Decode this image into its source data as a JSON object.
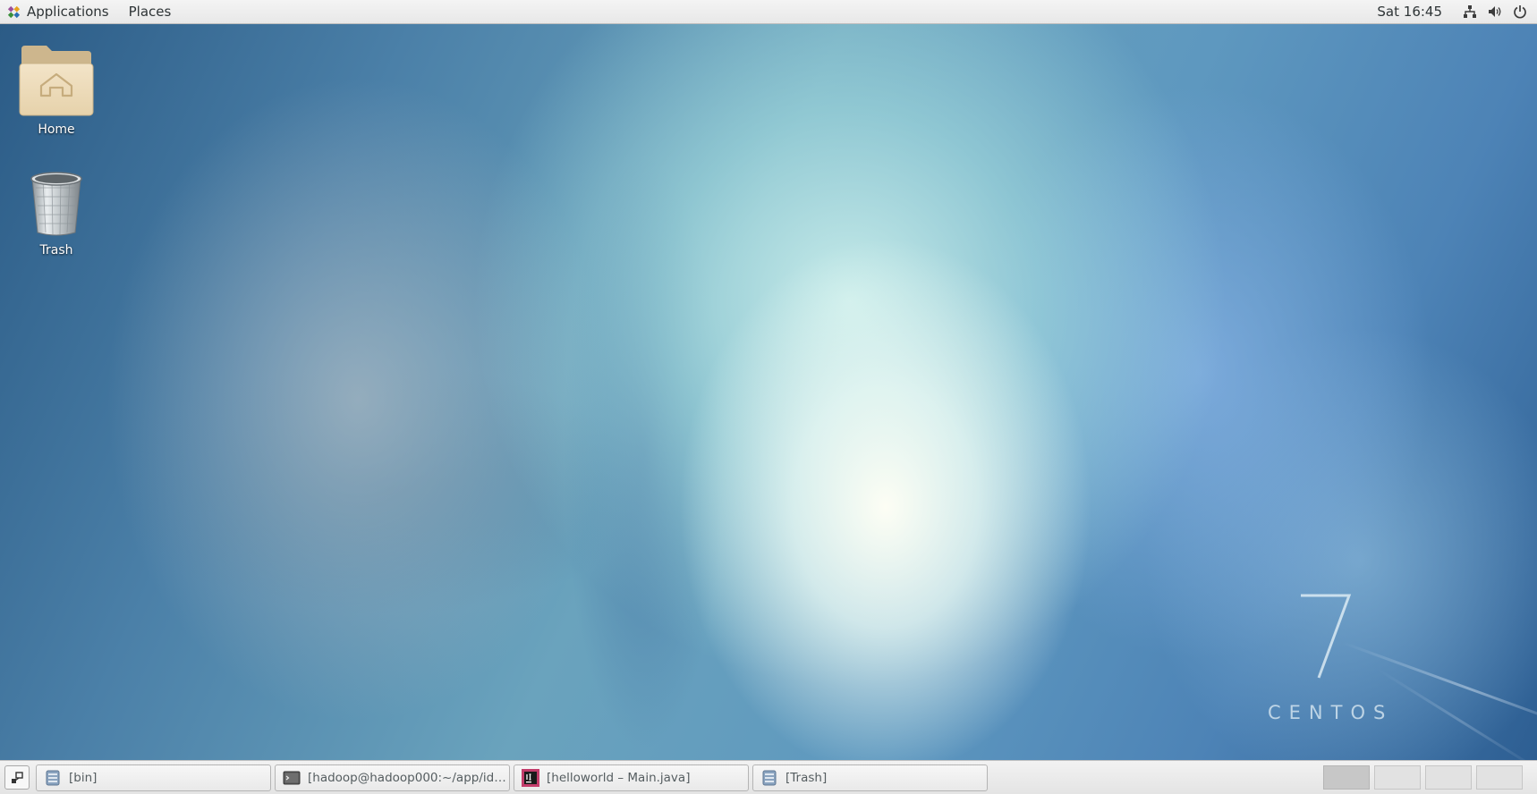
{
  "topbar": {
    "applications_label": "Applications",
    "places_label": "Places",
    "clock": "Sat 16:45"
  },
  "desktop": {
    "icons": [
      {
        "label": "Home",
        "icon": "home-folder-icon"
      },
      {
        "label": "Trash",
        "icon": "trash-icon"
      }
    ],
    "watermark": {
      "number": "7",
      "text": "CENTOS"
    }
  },
  "taskbar": {
    "tasks": [
      {
        "label": "[bin]",
        "icon": "file-manager-icon"
      },
      {
        "label": "[hadoop@hadoop000:~/app/idea-IU-...",
        "icon": "terminal-icon"
      },
      {
        "label": "[helloworld – Main.java]",
        "icon": "intellij-idea-icon"
      },
      {
        "label": "[Trash]",
        "icon": "file-manager-icon"
      }
    ],
    "workspaces": {
      "count": 4,
      "active_index": 0
    }
  },
  "colors": {
    "panel_bg": "#ececec",
    "text": "#2e3436",
    "desktop_accent": "#4d83b6"
  }
}
